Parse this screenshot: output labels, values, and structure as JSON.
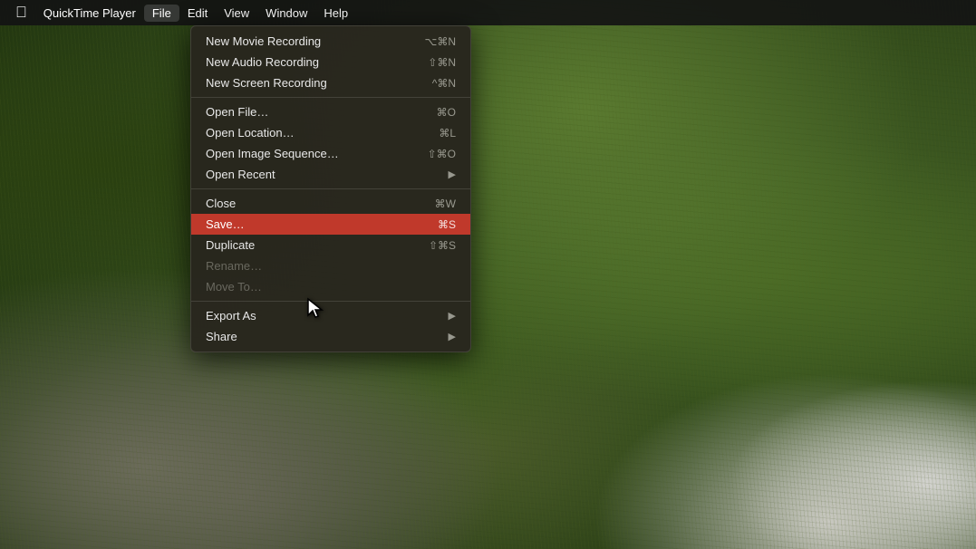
{
  "app": {
    "name": "QuickTime Player"
  },
  "menubar": {
    "apple_symbol": "",
    "items": [
      {
        "label": "QuickTime Player",
        "active": false
      },
      {
        "label": "File",
        "active": true
      },
      {
        "label": "Edit",
        "active": false
      },
      {
        "label": "View",
        "active": false
      },
      {
        "label": "Window",
        "active": false
      },
      {
        "label": "Help",
        "active": false
      }
    ]
  },
  "file_menu": {
    "items": [
      {
        "id": "new-movie-recording",
        "label": "New Movie Recording",
        "shortcut": "⌥⌘N",
        "disabled": false,
        "separator_after": false,
        "highlighted": false,
        "has_arrow": false
      },
      {
        "id": "new-audio-recording",
        "label": "New Audio Recording",
        "shortcut": "⇧⌘N",
        "disabled": false,
        "separator_after": false,
        "highlighted": false,
        "has_arrow": false
      },
      {
        "id": "new-screen-recording",
        "label": "New Screen Recording",
        "shortcut": "^⌘N",
        "disabled": false,
        "separator_after": true,
        "highlighted": false,
        "has_arrow": false
      },
      {
        "id": "open-file",
        "label": "Open File…",
        "shortcut": "⌘O",
        "disabled": false,
        "separator_after": false,
        "highlighted": false,
        "has_arrow": false
      },
      {
        "id": "open-location",
        "label": "Open Location…",
        "shortcut": "⌘L",
        "disabled": false,
        "separator_after": false,
        "highlighted": false,
        "has_arrow": false
      },
      {
        "id": "open-image-sequence",
        "label": "Open Image Sequence…",
        "shortcut": "⇧⌘O",
        "disabled": false,
        "separator_after": false,
        "highlighted": false,
        "has_arrow": false
      },
      {
        "id": "open-recent",
        "label": "Open Recent",
        "shortcut": "",
        "disabled": false,
        "separator_after": true,
        "highlighted": false,
        "has_arrow": true
      },
      {
        "id": "close",
        "label": "Close",
        "shortcut": "⌘W",
        "disabled": false,
        "separator_after": false,
        "highlighted": false,
        "has_arrow": false
      },
      {
        "id": "save",
        "label": "Save…",
        "shortcut": "⌘S",
        "disabled": false,
        "separator_after": false,
        "highlighted": true,
        "has_arrow": false
      },
      {
        "id": "duplicate",
        "label": "Duplicate",
        "shortcut": "⇧⌘S",
        "disabled": false,
        "separator_after": false,
        "highlighted": false,
        "has_arrow": false
      },
      {
        "id": "rename",
        "label": "Rename…",
        "shortcut": "",
        "disabled": true,
        "separator_after": false,
        "highlighted": false,
        "has_arrow": false
      },
      {
        "id": "move-to",
        "label": "Move To…",
        "shortcut": "",
        "disabled": true,
        "separator_after": true,
        "highlighted": false,
        "has_arrow": false
      },
      {
        "id": "export-as",
        "label": "Export As",
        "shortcut": "",
        "disabled": false,
        "separator_after": false,
        "highlighted": false,
        "has_arrow": true
      },
      {
        "id": "share",
        "label": "Share",
        "shortcut": "",
        "disabled": false,
        "separator_after": false,
        "highlighted": false,
        "has_arrow": true
      }
    ]
  }
}
